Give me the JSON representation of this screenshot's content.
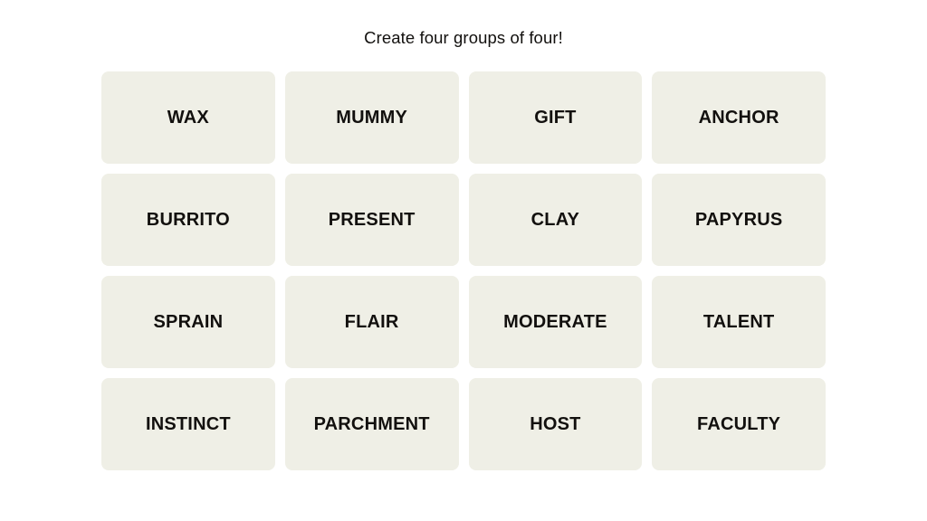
{
  "header": {
    "instruction": "Create four groups of four!"
  },
  "colors": {
    "page_background": "#ffffff",
    "tile_background": "#efefe6",
    "text": "#12100e"
  },
  "board": {
    "rows": 4,
    "columns": 4,
    "tiles": [
      {
        "label": "WAX"
      },
      {
        "label": "MUMMY"
      },
      {
        "label": "GIFT"
      },
      {
        "label": "ANCHOR"
      },
      {
        "label": "BURRITO"
      },
      {
        "label": "PRESENT"
      },
      {
        "label": "CLAY"
      },
      {
        "label": "PAPYRUS"
      },
      {
        "label": "SPRAIN"
      },
      {
        "label": "FLAIR"
      },
      {
        "label": "MODERATE"
      },
      {
        "label": "TALENT"
      },
      {
        "label": "INSTINCT"
      },
      {
        "label": "PARCHMENT"
      },
      {
        "label": "HOST"
      },
      {
        "label": "FACULTY"
      }
    ]
  }
}
